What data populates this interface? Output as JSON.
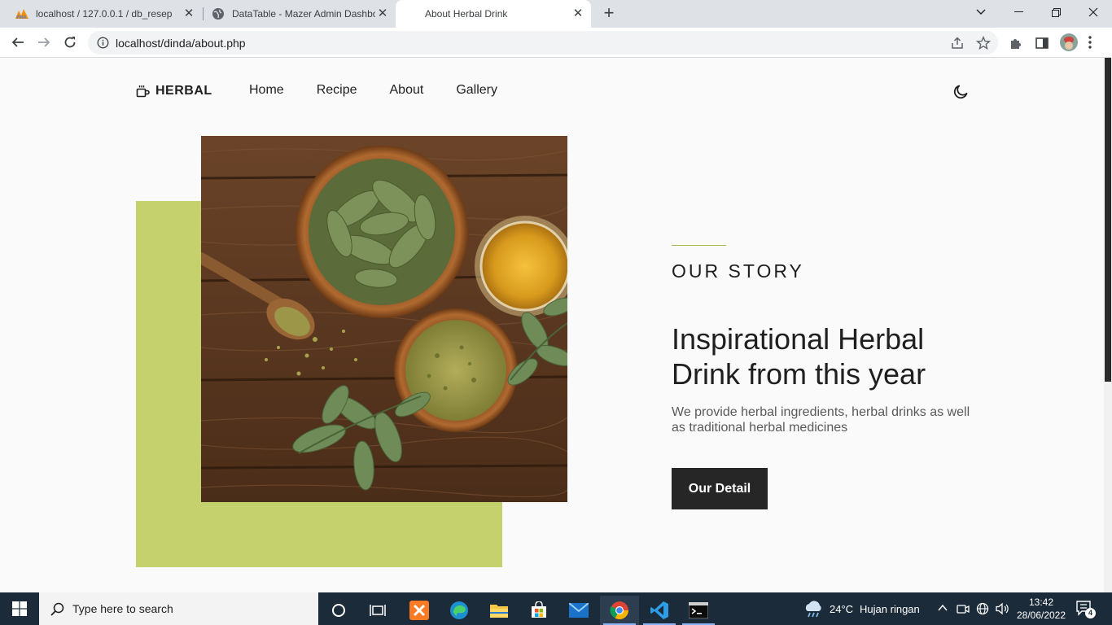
{
  "browser": {
    "tabs": [
      {
        "label": "localhost / 127.0.0.1 / db_resep | ",
        "icon": "phpmyadmin-icon"
      },
      {
        "label": "DataTable - Mazer Admin Dashbo",
        "icon": "globe-icon"
      },
      {
        "label": "About Herbal Drink",
        "icon": "none"
      }
    ],
    "url": "localhost/dinda/about.php"
  },
  "site": {
    "brand": "HERBAL",
    "nav": [
      "Home",
      "Recipe",
      "About",
      "Gallery"
    ],
    "eyebrow": "OUR STORY",
    "headline": "Inspirational Herbal Drink from this year",
    "description": "We provide herbal ingredients, herbal drinks as well as traditional herbal medicines",
    "cta_label": "Our Detail",
    "accent_color": "#c5d16d",
    "dark_color": "#262626"
  },
  "taskbar": {
    "search_placeholder": "Type here to search",
    "weather_temp": "24°C",
    "weather_desc": "Hujan ringan",
    "time": "13:42",
    "date": "28/06/2022",
    "notification_count": "4"
  }
}
